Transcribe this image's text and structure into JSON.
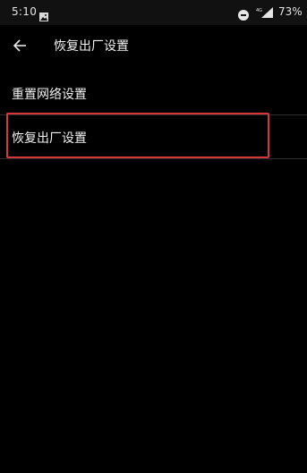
{
  "status_bar": {
    "time": "5:10",
    "battery": "73%",
    "network_badge": "4G",
    "icons": [
      "photo-icon",
      "do-not-disturb-icon",
      "signal-icon"
    ]
  },
  "header": {
    "title": "恢复出厂设置",
    "back_icon": "back-arrow-icon"
  },
  "list": {
    "items": [
      {
        "label": "重置网络设置"
      },
      {
        "label": "恢复出厂设置"
      }
    ]
  },
  "colors": {
    "background": "#000000",
    "text": "#f0f0f0",
    "divider": "#2b2b2b",
    "highlight": "#d8363a"
  }
}
